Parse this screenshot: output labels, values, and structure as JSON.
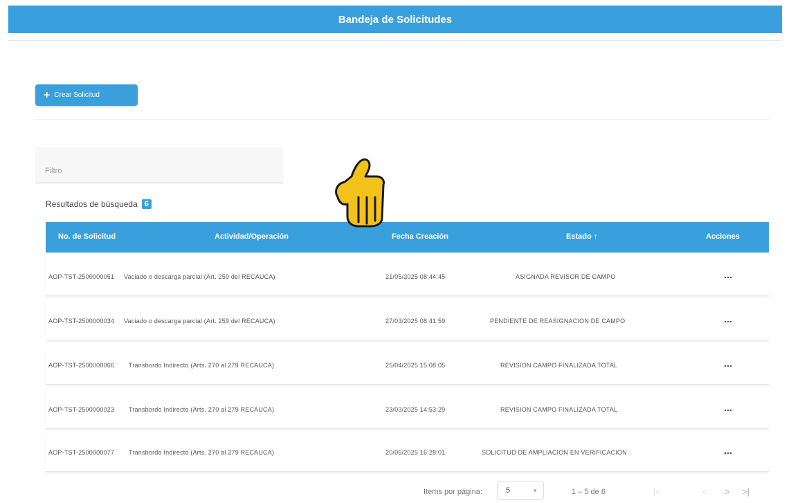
{
  "header": {
    "title": "Bandeja de Solicitudes"
  },
  "toolbar": {
    "create_label": "Crear Solicitud"
  },
  "filter": {
    "placeholder": "Filtro",
    "value": ""
  },
  "results": {
    "label": "Resultados de búsqueda",
    "count": "6"
  },
  "table": {
    "headers": {
      "no": "No. de Solicitud",
      "actividad": "Actividad/Operación",
      "fecha": "Fecha Creación",
      "estado": "Estado ↑",
      "acciones": "Acciones"
    },
    "rows": [
      {
        "no": "AOP-TST-2500000051",
        "actividad": "Vaciado o descarga parcial (Art. 259 del RECAUCA)",
        "fecha": "21/05/2025 08:44:45",
        "estado": "ASIGNADA REVISOR DE CAMPO",
        "acciones": "..."
      },
      {
        "no": "AOP-TST-2500000034",
        "actividad": "Vaciado o descarga parcial (Art. 259 del RECAUCA)",
        "fecha": "27/03/2025 08:41:59",
        "estado": "PENDIENTE DE REASIGNACION DE CAMPO",
        "acciones": "..."
      },
      {
        "no": "AOP-TST-2500000066",
        "actividad": "Transbordo Indirecto (Arts. 270 al 279 RECAUCA)",
        "fecha": "25/04/2025 15:08:05",
        "estado": "REVISION CAMPO FINALIZADA TOTAL",
        "acciones": "..."
      },
      {
        "no": "AOP-TST-2500000023",
        "actividad": "Transbordo Indirecto (Arts. 270 al 279 RECAUCA)",
        "fecha": "23/03/2025 14:53:29",
        "estado": "REVISION CAMPO FINALIZADA TOTAL",
        "acciones": "..."
      },
      {
        "no": "AOP-TST-2500000077",
        "actividad": "Transbordo Indirecto (Arts. 270 al 279 RECAUCA)",
        "fecha": "20/05/2025 16:28:01",
        "estado": "SOLICITUD DE AMPLIACION EN VERIFICACION",
        "acciones": "..."
      }
    ]
  },
  "paginator": {
    "items_label": "Items por página:",
    "page_size": "5",
    "range": "1 – 5 de 6",
    "first": "|<",
    "prev": "<",
    "next": ">",
    "last": ">|"
  },
  "icons": {
    "create": "plus-icon",
    "pointer": "pointing-hand-icon"
  },
  "colors": {
    "accent": "#3aa0dd",
    "hand": "#f2c21b"
  }
}
